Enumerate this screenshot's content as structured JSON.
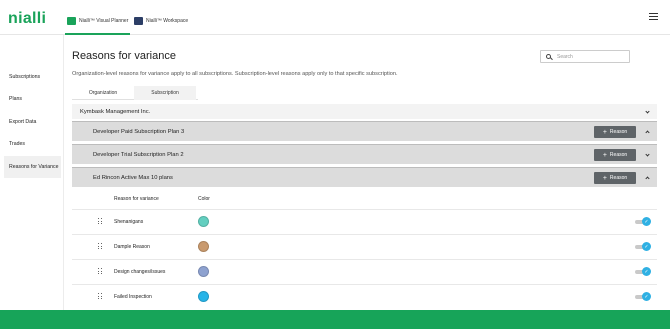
{
  "header": {
    "logo": "nialli",
    "apps": [
      {
        "label": "Nialli™ Visual Planner",
        "icon": "planner-app-icon",
        "active": true
      },
      {
        "label": "Nialli™ Workspace",
        "icon": "workspace-app-icon",
        "active": false
      }
    ]
  },
  "sidebar": {
    "items": [
      {
        "label": "Subscriptions",
        "active": false
      },
      {
        "label": "Plans",
        "active": false
      },
      {
        "label": "Export Data",
        "active": false
      },
      {
        "label": "Trades",
        "active": false
      },
      {
        "label": "Reasons for Variance",
        "active": true
      }
    ]
  },
  "main": {
    "title": "Reasons for variance",
    "description": "Organization-level reasons for variance apply to all subscriptions. Subscription-level reasons apply only to that specific subscription.",
    "search": {
      "placeholder": "Search",
      "value": ""
    },
    "tabs": [
      {
        "label": "Organization",
        "active": false
      },
      {
        "label": "Subscription",
        "active": true
      }
    ],
    "company": "Kymbask Management Inc.",
    "add_reason_label": "Reason",
    "plans": [
      {
        "name": "Developer Paid Subscription Plan 3",
        "expanded": true
      },
      {
        "name": "Developer Trial Subscription Plan 2",
        "expanded": false
      },
      {
        "name": "Ed Rincon Active Max 10 plans",
        "expanded": true
      }
    ],
    "table": {
      "headers": {
        "reason": "Reason for variance",
        "color": "Color"
      },
      "rows": [
        {
          "reason": "Shenanigans",
          "color": "#63cfc0",
          "enabled": true
        },
        {
          "reason": "Dample Reason",
          "color": "#c99a6e",
          "enabled": true
        },
        {
          "reason": "Design changes/issues",
          "color": "#8ea2d0",
          "enabled": true
        },
        {
          "reason": "Failed Inspection",
          "color": "#27b4e8",
          "enabled": true
        }
      ]
    }
  },
  "colors": {
    "brand_green": "#17a459",
    "toggle_on": "#2fb0e3",
    "button_dark": "#5f6468"
  }
}
